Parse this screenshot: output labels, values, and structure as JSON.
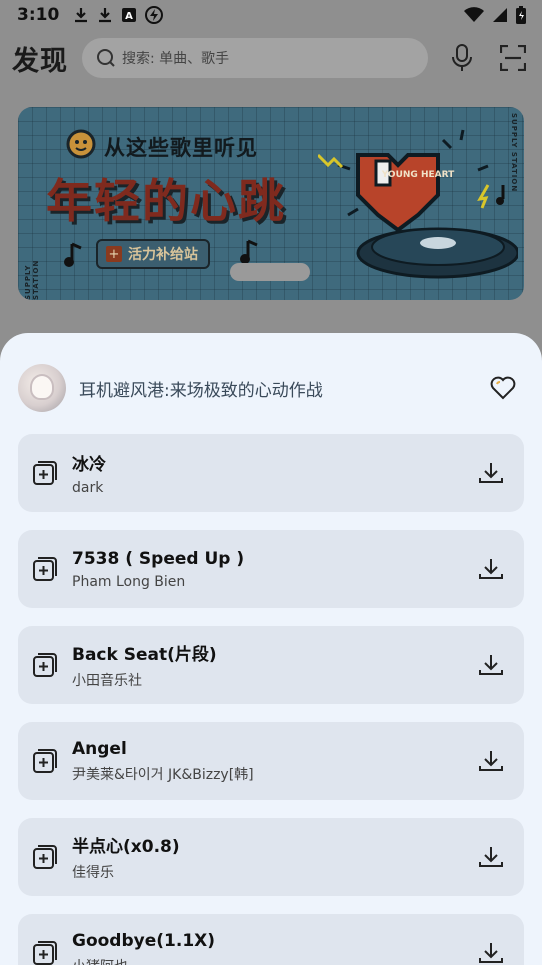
{
  "status_bar": {
    "time": "3:10",
    "left_icons": [
      "download-icon",
      "download-icon",
      "app-icon",
      "flash-icon"
    ],
    "right_icons": [
      "wifi-icon",
      "signal-icon",
      "battery-icon"
    ]
  },
  "header": {
    "title": "发现",
    "search_placeholder": "搜索: 单曲、歌手",
    "icons": [
      "mic-icon",
      "scan-icon"
    ]
  },
  "banner": {
    "line1": "从这些歌里听见",
    "line2": "年轻的心跳",
    "tag": "活力补给站",
    "side_text": "SUPPLY STATION",
    "art_text": "YOUNG HEART",
    "colors": {
      "background": "#3f6a7d",
      "headline": "#7f2a1e",
      "heart": "#b8442a"
    }
  },
  "sheet": {
    "title": "耳机避风港:来场极致的心动作战",
    "favorite_icon": "heart-icon",
    "songs": [
      {
        "name": "冰冷",
        "artist": "dark"
      },
      {
        "name": "7538 ( Speed Up )",
        "artist": "Pham Long Bien"
      },
      {
        "name": "Back Seat(片段)",
        "artist": "小田音乐社"
      },
      {
        "name": "Angel",
        "artist": "尹美莱&타이거 JK&Bizzy[韩]"
      },
      {
        "name": "半点心(x0.8)",
        "artist": "佳得乐"
      },
      {
        "name": "Goodbye(1.1X)",
        "artist": "小猪阿也"
      }
    ],
    "colors": {
      "sheet_bg": "#eef4fc",
      "row_bg": "#dfe5ee",
      "title": "#3a4a5a"
    }
  }
}
